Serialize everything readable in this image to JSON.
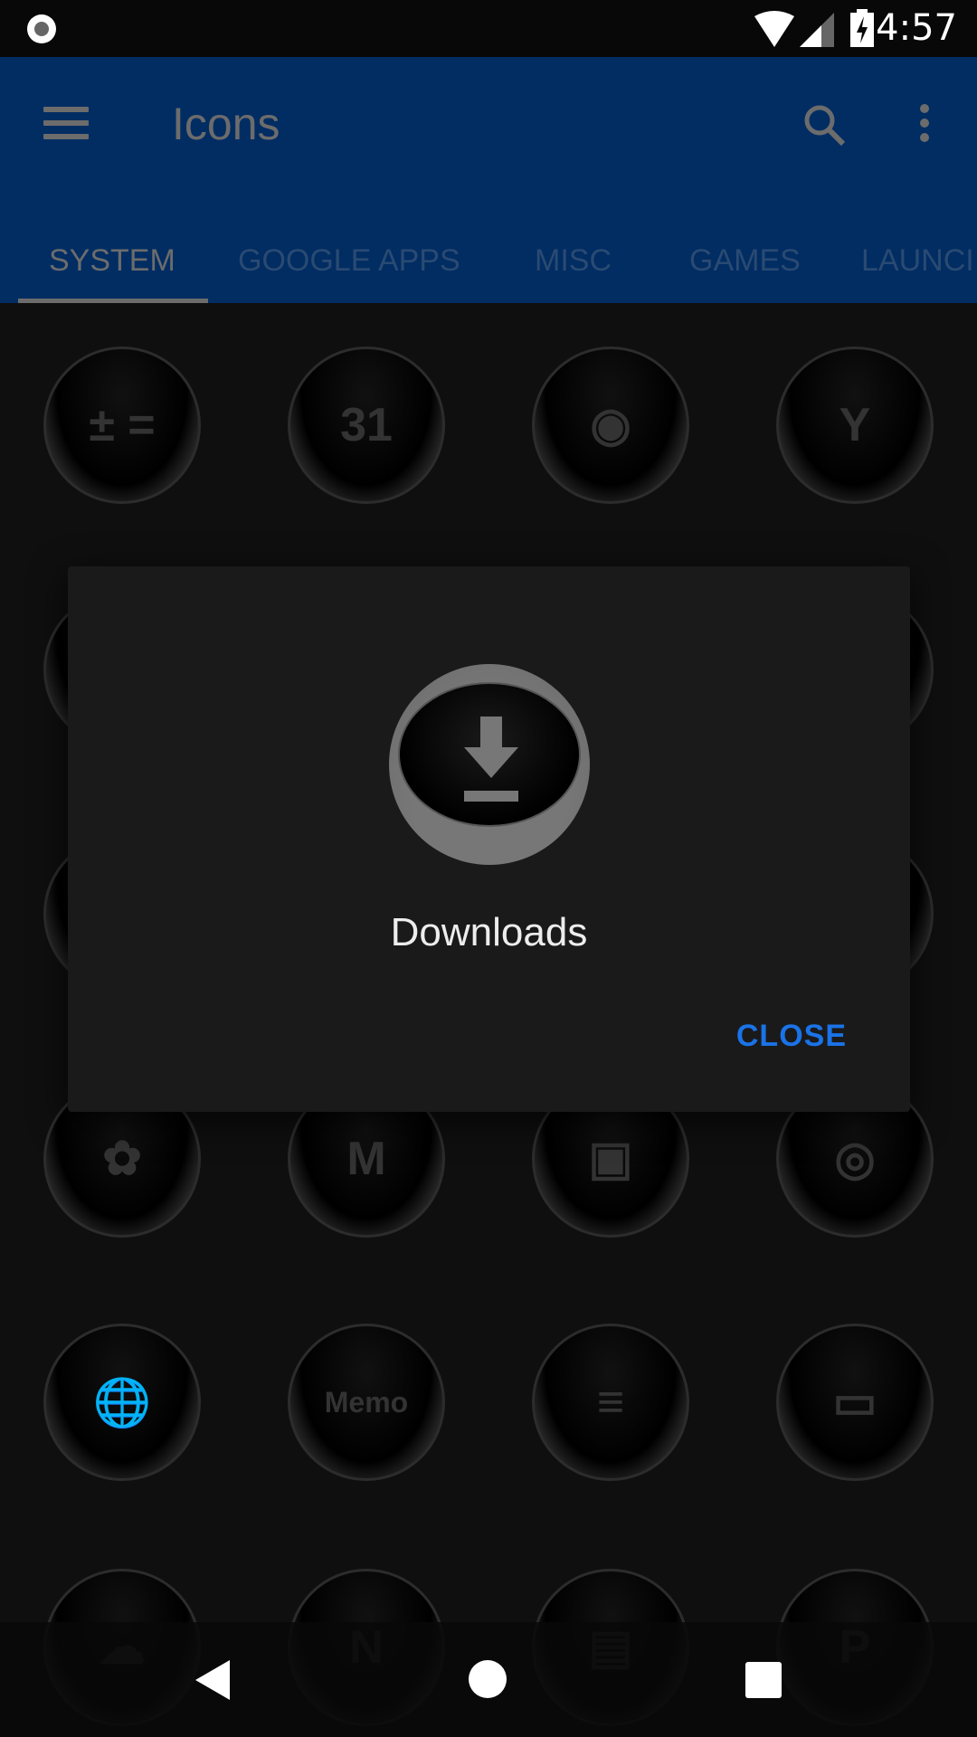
{
  "status_bar": {
    "time": "4:57",
    "icons": [
      "record-icon",
      "wifi-icon",
      "signal-icon",
      "battery-charging-icon"
    ]
  },
  "app_bar": {
    "title": "Icons",
    "icons": [
      "menu-icon",
      "search-icon",
      "more-vert-icon"
    ],
    "color": "#012d63"
  },
  "tabs": [
    {
      "label": "SYSTEM",
      "active": true
    },
    {
      "label": "GOOGLE APPS"
    },
    {
      "label": "MISC"
    },
    {
      "label": "GAMES"
    },
    {
      "label": "LAUNCI"
    }
  ],
  "grid": {
    "rows": [
      [
        {
          "icon": "calculator-icon",
          "text": "± ="
        },
        {
          "icon": "calendar-icon",
          "text": "31"
        },
        {
          "icon": "camera-icon",
          "text": "◉"
        },
        {
          "icon": "clock-icon",
          "text": "Y"
        }
      ],
      [
        {
          "icon": "hidden-icon",
          "text": ""
        },
        {
          "icon": "hidden-icon",
          "text": ""
        },
        {
          "icon": "hidden-icon",
          "text": ""
        },
        {
          "icon": "hidden-icon",
          "text": ""
        }
      ],
      [
        {
          "icon": "hidden-icon",
          "text": ""
        },
        {
          "icon": "hidden-icon",
          "text": ""
        },
        {
          "icon": "hidden-icon",
          "text": ""
        },
        {
          "icon": "hidden-icon",
          "text": ""
        }
      ],
      [
        {
          "icon": "photos-icon",
          "text": "✿"
        },
        {
          "icon": "gmail-icon",
          "text": "M"
        },
        {
          "icon": "paint-icon",
          "text": "▣"
        },
        {
          "icon": "instagram-icon",
          "text": "◎"
        }
      ],
      [
        {
          "icon": "globe-icon",
          "text": "🌐"
        },
        {
          "icon": "memo-icon",
          "text": "Memo"
        },
        {
          "icon": "messages-icon",
          "text": "≡"
        },
        {
          "icon": "folder-icon",
          "text": "▭"
        }
      ],
      [
        {
          "icon": "cloud-icon",
          "text": "☁"
        },
        {
          "icon": "onenote-icon",
          "text": "N"
        },
        {
          "icon": "sd-card-icon",
          "text": "▤"
        },
        {
          "icon": "chat-icon",
          "text": "P"
        }
      ]
    ]
  },
  "dialog": {
    "icon": "download-icon",
    "label": "Downloads",
    "close_label": "CLOSE",
    "accent": "#1a73e8"
  },
  "nav_bar": {
    "icons": [
      "back-icon",
      "home-icon",
      "recents-icon"
    ]
  }
}
